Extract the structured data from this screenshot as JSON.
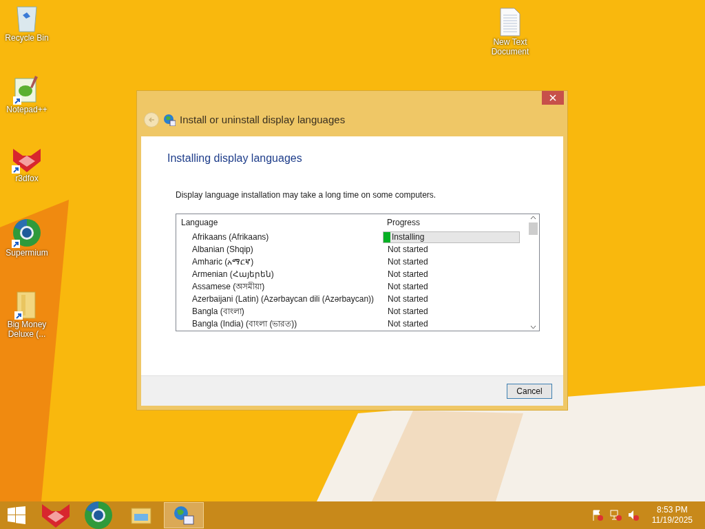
{
  "desktop_icons": [
    {
      "kind": "recycle",
      "label": "Recycle Bin"
    },
    {
      "kind": "notepad",
      "label": "Notepad++"
    },
    {
      "kind": "fox",
      "label": "r3dfox"
    },
    {
      "kind": "browser",
      "label": "Supermium"
    },
    {
      "kind": "folder",
      "label": "Big Money Deluxe (..."
    }
  ],
  "desktop_icons_right": [
    {
      "kind": "textfile",
      "label": "New Text Document"
    }
  ],
  "window": {
    "title": "Install or uninstall display languages",
    "heading": "Installing display languages",
    "note": "Display language installation may take a long time on some computers.",
    "table": {
      "columns": [
        "Language",
        "Progress"
      ],
      "rows": [
        {
          "language": "Afrikaans (Afrikaans)",
          "kind": "progress",
          "status": "Installing",
          "level": 0.05
        },
        {
          "language": "Albanian (Shqip)",
          "kind": "text",
          "status": "Not started"
        },
        {
          "language": "Amharic (አማርኛ)",
          "kind": "text",
          "status": "Not started"
        },
        {
          "language": "Armenian (Հայերեն)",
          "kind": "text",
          "status": "Not started"
        },
        {
          "language": "Assamese (অসমীয়া)",
          "kind": "text",
          "status": "Not started"
        },
        {
          "language": "Azerbaijani (Latin) (Azərbaycan dili (Azərbaycan))",
          "kind": "text",
          "status": "Not started"
        },
        {
          "language": "Bangla (বাংলা)",
          "kind": "text",
          "status": "Not started"
        },
        {
          "language": "Bangla (India) (বাংলা (ভারত))",
          "kind": "text",
          "status": "Not started"
        }
      ]
    },
    "buttons": [
      "Cancel"
    ]
  },
  "taskbar": {
    "apps": [
      {
        "kind": "fox",
        "active": false
      },
      {
        "kind": "browser",
        "active": false
      },
      {
        "kind": "explorer",
        "active": false
      },
      {
        "kind": "language",
        "active": true
      }
    ],
    "time": "8:53 PM",
    "date": "11/19/2025"
  }
}
